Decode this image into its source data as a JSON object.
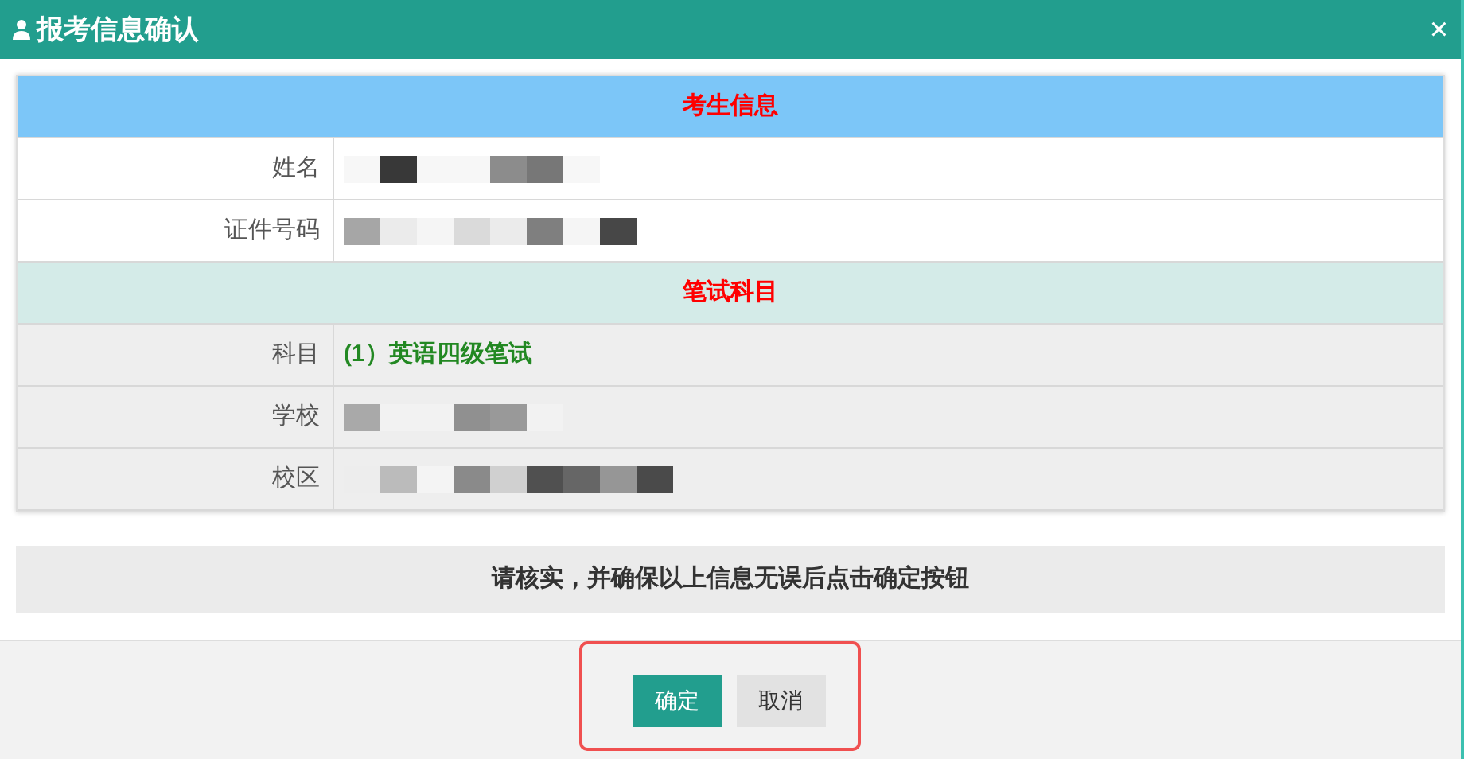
{
  "window": {
    "title": "报考信息确认",
    "close": "×"
  },
  "sections": [
    {
      "title": "考生信息",
      "kind": "info",
      "rows": [
        {
          "label": "姓名",
          "kind": "redacted"
        },
        {
          "label": "证件号码",
          "kind": "redacted"
        }
      ]
    },
    {
      "title": "笔试科目",
      "kind": "exam",
      "rows": [
        {
          "label": "科目",
          "kind": "text",
          "value": "(1）英语四级笔试"
        },
        {
          "label": "学校",
          "kind": "redacted"
        },
        {
          "label": "校区",
          "kind": "redacted"
        }
      ]
    }
  ],
  "notice": "请核实，并确保以上信息无误后点击确定按钮",
  "buttons": [
    {
      "label": "确定",
      "kind": "primary"
    },
    {
      "label": "取消",
      "kind": "secondary"
    }
  ]
}
